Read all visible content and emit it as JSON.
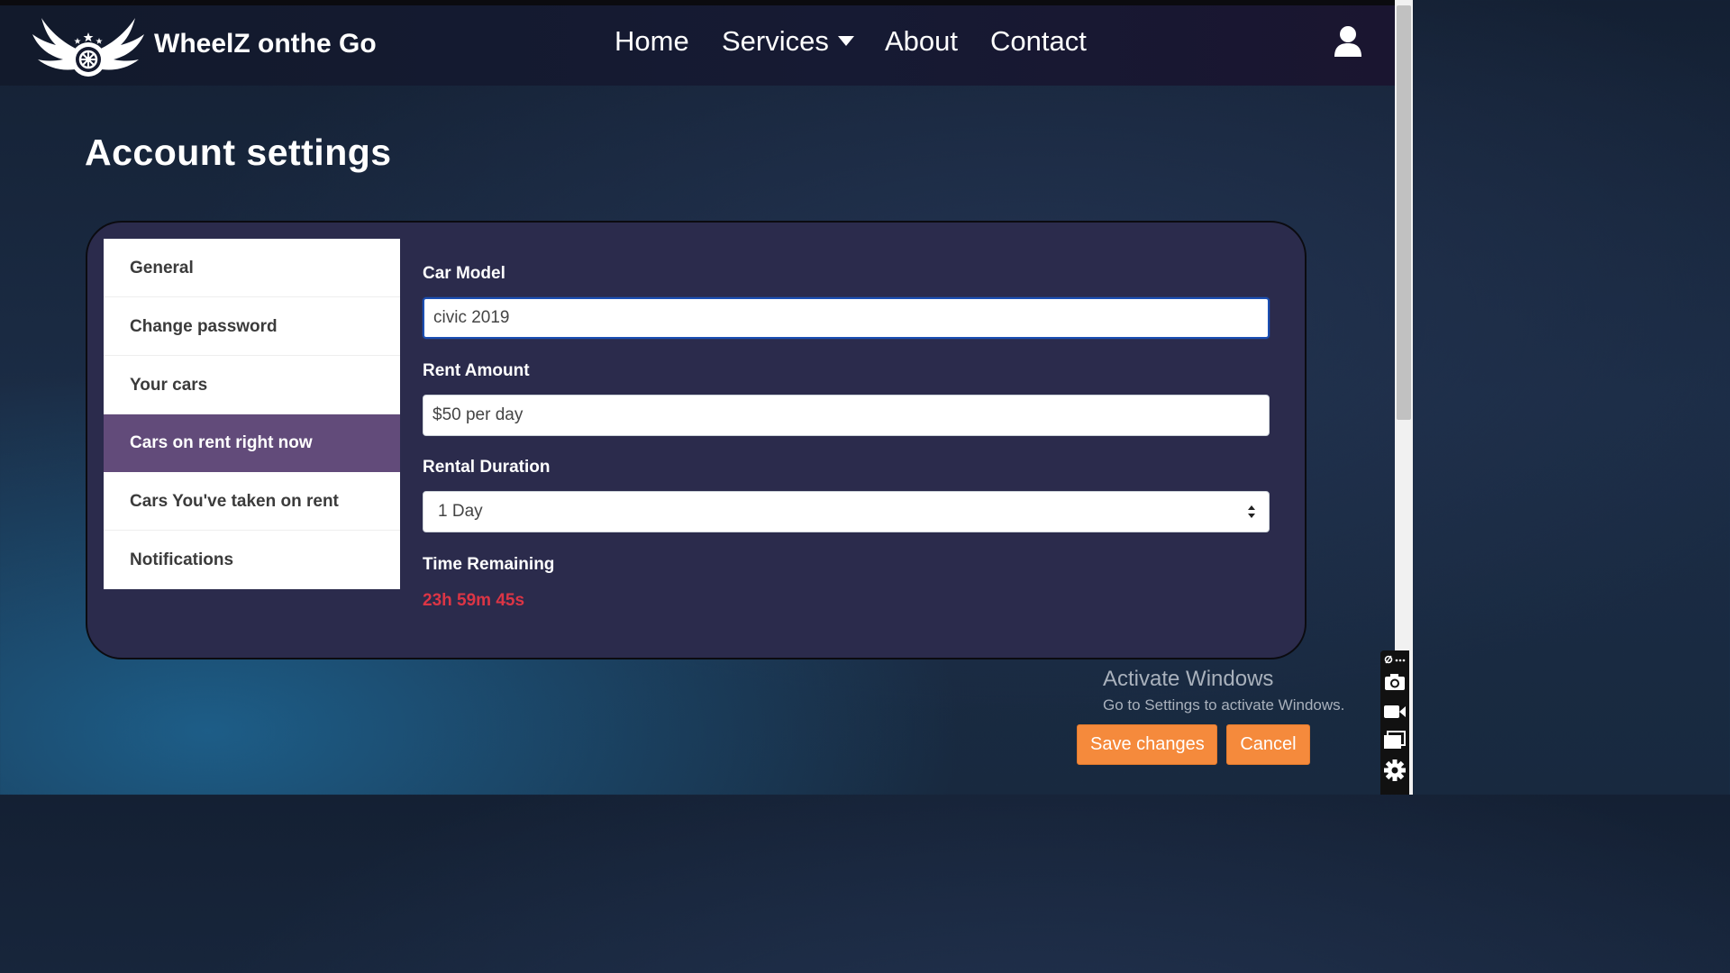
{
  "brand": {
    "name": "WheelZ onthe Go"
  },
  "nav": {
    "home": "Home",
    "services": "Services",
    "about": "About",
    "contact": "Contact"
  },
  "page": {
    "title": "Account settings"
  },
  "sidebar": {
    "items": [
      {
        "label": "General"
      },
      {
        "label": "Change password"
      },
      {
        "label": "Your cars"
      },
      {
        "label": "Cars on rent right now",
        "active": true
      },
      {
        "label": "Cars You've taken on rent"
      },
      {
        "label": "Notifications"
      }
    ]
  },
  "form": {
    "car_model": {
      "label": "Car Model",
      "value": "civic 2019"
    },
    "rent_amount": {
      "label": "Rent Amount",
      "value": "$50 per day"
    },
    "rental_duration": {
      "label": "Rental Duration",
      "value": "1 Day"
    },
    "time_remaining": {
      "label": "Time Remaining",
      "value": "23h 59m 45s"
    }
  },
  "actions": {
    "save": "Save changes",
    "cancel": "Cancel"
  },
  "watermark": {
    "title": "Activate Windows",
    "subtitle": "Go to Settings to activate Windows."
  },
  "icons": {
    "logo": "winged-wheel-logo",
    "user": "user-icon",
    "caret": "caret-down-icon",
    "select": "select-arrows-icon"
  },
  "colors": {
    "accent": "#f58a3c",
    "active_menu": "#624b7a",
    "timer": "#dc3545",
    "card": "#2b2b4c",
    "focus": "#1b4fb3"
  }
}
